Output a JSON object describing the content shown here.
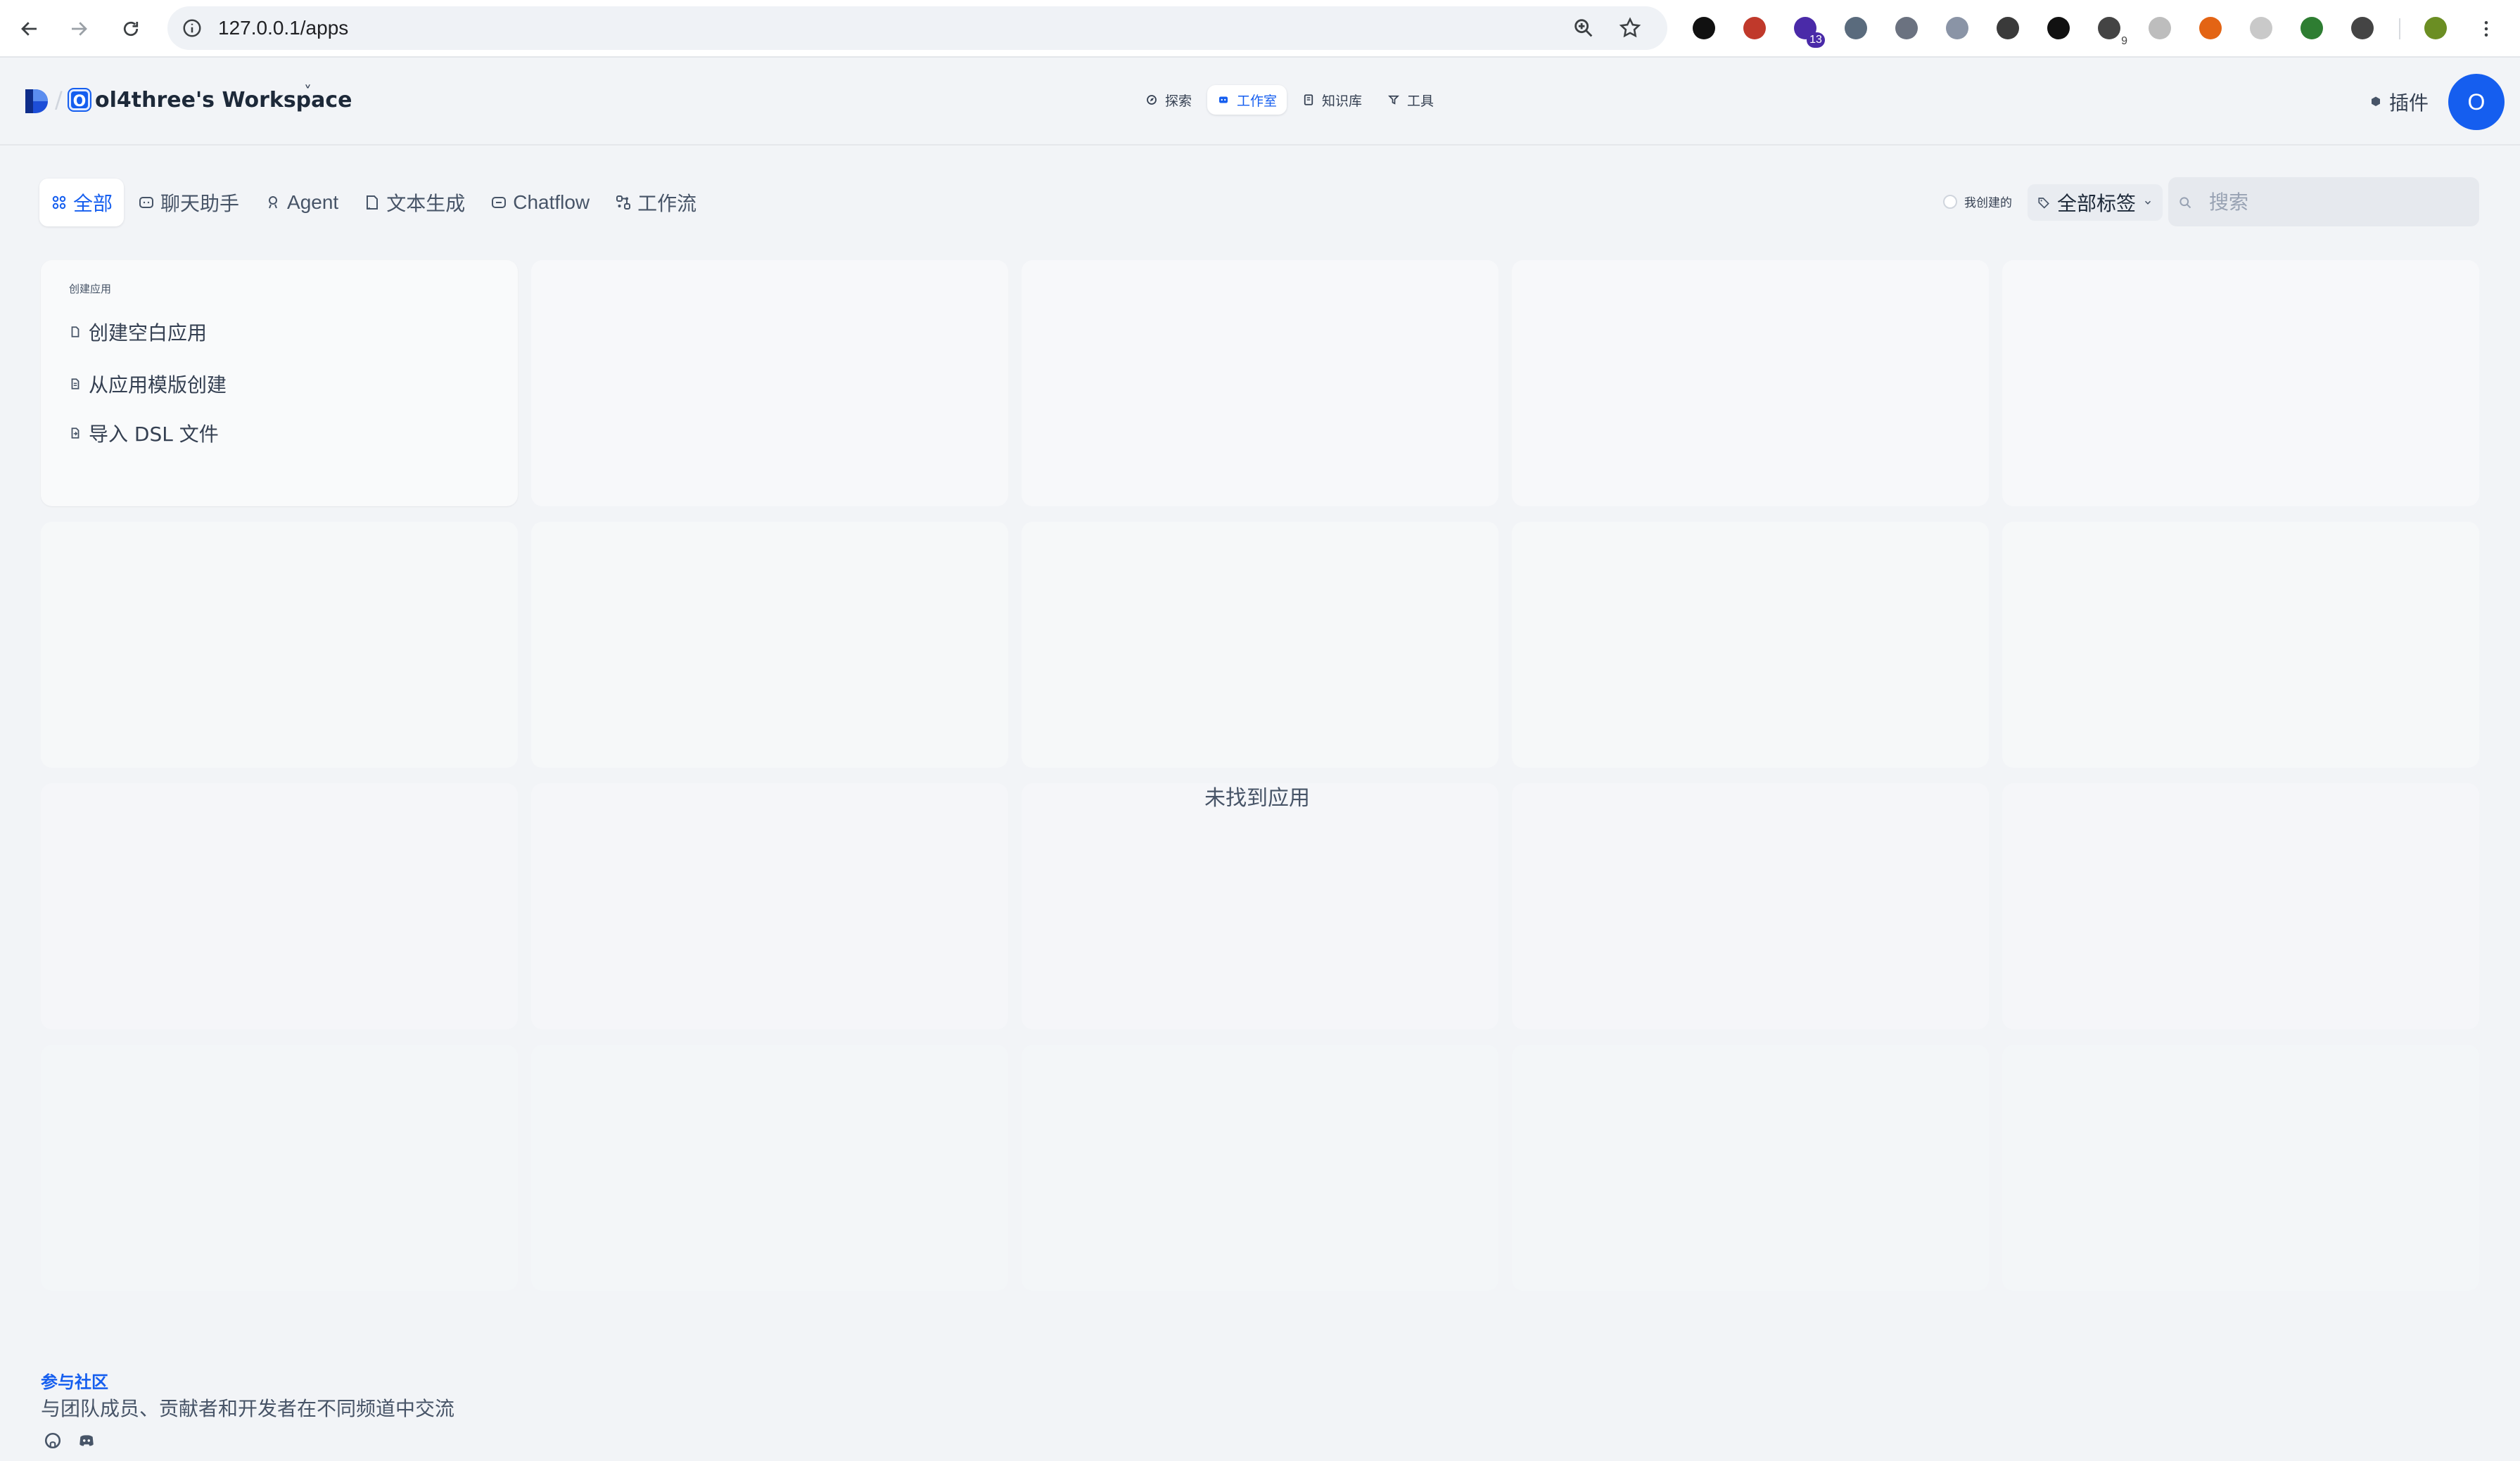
{
  "browser": {
    "url": "127.0.0.1/apps",
    "extensions": [
      {
        "icon": "circle-dark-icon",
        "color": "#111111"
      },
      {
        "icon": "glasses-icon",
        "color": "#c0392b"
      },
      {
        "icon": "cap-icon",
        "color": "#4a2aa8",
        "badge": "13"
      },
      {
        "icon": "satellite-icon",
        "color": "#5a6b7d"
      },
      {
        "icon": "ip-icon",
        "color": "#6b7280"
      },
      {
        "icon": "link-icon",
        "color": "#8a94a6"
      },
      {
        "icon": "planet-icon",
        "color": "#3a3a3a"
      },
      {
        "icon": "notion-icon",
        "color": "#111111"
      },
      {
        "icon": "scan-icon",
        "color": "#444444",
        "sub": "9"
      },
      {
        "icon": "gear-grey-icon",
        "color": "#bdbdbd"
      },
      {
        "icon": "cookie-icon",
        "color": "#e36414"
      },
      {
        "icon": "ip-light-icon",
        "color": "#c9c9c9"
      },
      {
        "icon": "refresh-green-icon",
        "color": "#2e7d32"
      },
      {
        "icon": "puzzle-icon",
        "color": "#444444"
      },
      {
        "icon": "profile-icon",
        "color": "#6b8e23"
      }
    ]
  },
  "header": {
    "workspace_initial": "O",
    "workspace_name": "ol4three's Workspace",
    "workspace_caret": "˅",
    "nav": [
      {
        "label": "探索",
        "icon": "explore-icon"
      },
      {
        "label": "工作室",
        "icon": "studio-icon",
        "active": true
      },
      {
        "label": "知识库",
        "icon": "knowledge-icon"
      },
      {
        "label": "工具",
        "icon": "tools-icon"
      }
    ],
    "plugins_label": "插件",
    "user_initial": "O"
  },
  "filters": {
    "tabs": [
      {
        "label": "全部",
        "icon": "grid-icon",
        "active": true
      },
      {
        "label": "聊天助手",
        "icon": "chat-icon"
      },
      {
        "label": "Agent",
        "icon": "agent-icon"
      },
      {
        "label": "文本生成",
        "icon": "document-icon"
      },
      {
        "label": "Chatflow",
        "icon": "chatflow-icon"
      },
      {
        "label": "工作流",
        "icon": "workflow-icon"
      }
    ],
    "mine_label": "我创建的",
    "tags_label": "全部标签",
    "search_placeholder": "搜索"
  },
  "create_card": {
    "title": "创建应用",
    "options": [
      "创建空白应用",
      "从应用模版创建",
      "导入 DSL 文件"
    ]
  },
  "empty_message": "未找到应用",
  "footer": {
    "title": "参与社区",
    "description": "与团队成员、贡献者和开发者在不同频道中交流"
  },
  "colors": {
    "accent": "#155eef",
    "background": "#f2f4f7"
  }
}
